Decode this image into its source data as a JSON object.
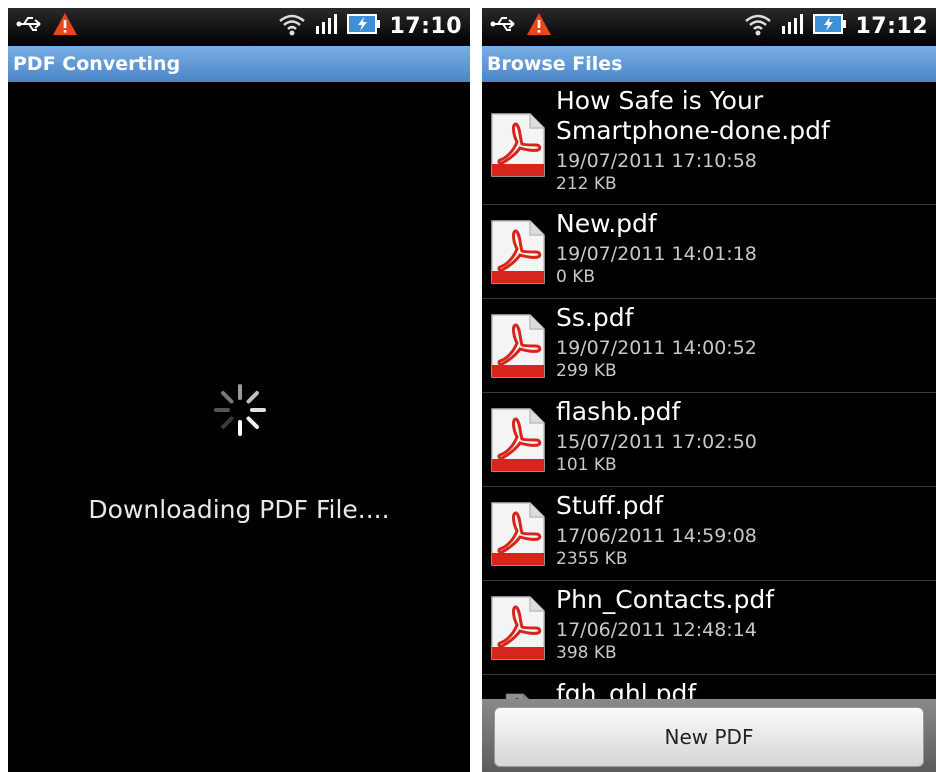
{
  "left_screen": {
    "status": {
      "time": "17:10",
      "icons": [
        "usb-icon",
        "warning-icon",
        "wifi-icon",
        "signal-icon",
        "battery-icon"
      ]
    },
    "title": "PDF Converting",
    "loading_text": "Downloading PDF File...."
  },
  "right_screen": {
    "status": {
      "time": "17:12",
      "icons": [
        "usb-icon",
        "warning-icon",
        "wifi-icon",
        "signal-icon",
        "battery-icon"
      ]
    },
    "title": "Browse Files",
    "files": [
      {
        "name": "How Safe is Your Smartphone-done.pdf",
        "date": "19/07/2011 17:10:58",
        "size": "212 KB"
      },
      {
        "name": "New.pdf",
        "date": "19/07/2011 14:01:18",
        "size": "0 KB"
      },
      {
        "name": "Ss.pdf",
        "date": "19/07/2011 14:00:52",
        "size": "299 KB"
      },
      {
        "name": "flashb.pdf",
        "date": "15/07/2011 17:02:50",
        "size": "101 KB"
      },
      {
        "name": "Stuff.pdf",
        "date": "17/06/2011 14:59:08",
        "size": "2355 KB"
      },
      {
        "name": "Phn_Contacts.pdf",
        "date": "17/06/2011 12:48:14",
        "size": "398 KB"
      },
      {
        "name": "fgh_ghl.pdf"
      }
    ],
    "new_pdf_label": "New PDF"
  },
  "colors": {
    "title_bar": "#5a94d6",
    "pdf_red": "#d8251c",
    "background": "#000000"
  }
}
